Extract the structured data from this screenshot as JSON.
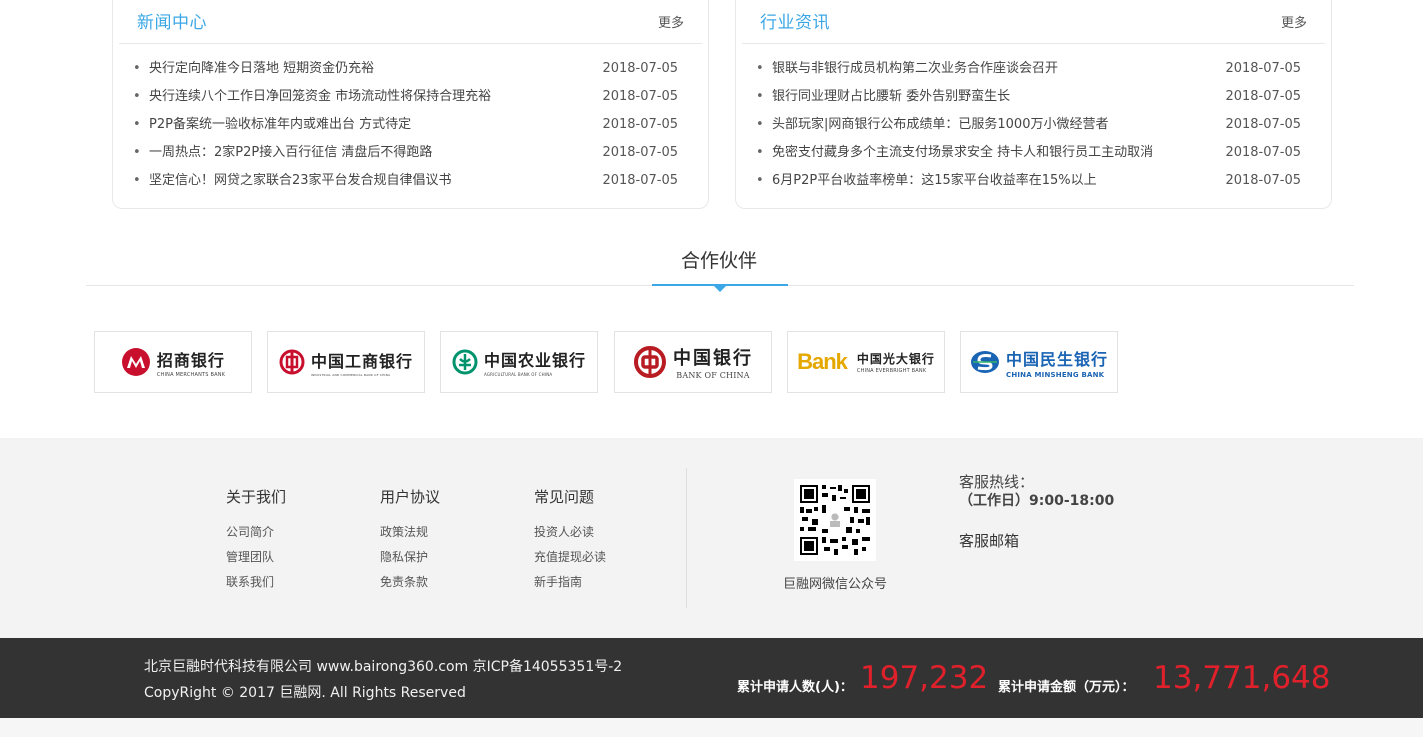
{
  "news": {
    "title": "新闻中心",
    "more": "更多",
    "items": [
      {
        "title": "央行定向降准今日落地 短期资金仍充裕",
        "date": "2018-07-05"
      },
      {
        "title": "央行连续八个工作日净回笼资金 市场流动性将保持合理充裕",
        "date": "2018-07-05"
      },
      {
        "title": "P2P备案统一验收标准年内或难出台 方式待定",
        "date": "2018-07-05"
      },
      {
        "title": "一周热点：2家P2P接入百行征信 清盘后不得跑路",
        "date": "2018-07-05"
      },
      {
        "title": "坚定信心！网贷之家联合23家平台发合规自律倡议书",
        "date": "2018-07-05"
      }
    ]
  },
  "industry": {
    "title": "行业资讯",
    "more": "更多",
    "items": [
      {
        "title": "银联与非银行成员机构第二次业务合作座谈会召开",
        "date": "2018-07-05"
      },
      {
        "title": "银行同业理财占比腰斩 委外告别野蛮生长",
        "date": "2018-07-05"
      },
      {
        "title": "头部玩家|网商银行公布成绩单：已服务1000万小微经营者",
        "date": "2018-07-05"
      },
      {
        "title": "免密支付藏身多个主流支付场景求安全 持卡人和银行员工主动取消",
        "date": "2018-07-05"
      },
      {
        "title": "6月P2P平台收益率榜单：这15家平台收益率在15%以上",
        "date": "2018-07-05"
      }
    ]
  },
  "partners": {
    "title": "合作伙伴",
    "logos": [
      {
        "cn": "招商银行",
        "en": "CHINA MERCHANTS BANK",
        "color": "#c8102e",
        "icon": "cmb-logo-icon"
      },
      {
        "cn": "中国工商银行",
        "en": "INDUSTRIAL AND COMMERCIAL BANK OF CHINA",
        "color": "#c8102e",
        "icon": "icbc-logo-icon"
      },
      {
        "cn": "中国农业银行",
        "en": "AGRICULTURAL BANK OF CHINA",
        "color": "#00936d",
        "icon": "abc-logo-icon"
      },
      {
        "cn": "中国银行",
        "en": "BANK OF CHINA",
        "color": "#b81c22",
        "icon": "boc-logo-icon"
      },
      {
        "cn": "中国光大银行",
        "en": "CHINA EVERBRIGHT BANK",
        "color": "#e5a800",
        "icon": "ceb-logo-icon",
        "mark": "Bank"
      },
      {
        "cn": "中国民生银行",
        "en": "CHINA MINSHENG BANK",
        "color": "#1a64b4",
        "icon": "cmbc-logo-icon"
      }
    ]
  },
  "footer": {
    "cols": [
      {
        "title": "关于我们",
        "links": [
          "公司简介",
          "管理团队",
          "联系我们"
        ]
      },
      {
        "title": "用户协议",
        "links": [
          "政策法规",
          "隐私保护",
          "免责条款"
        ]
      },
      {
        "title": "常见问题",
        "links": [
          "投资人必读",
          "充值提现必读",
          "新手指南"
        ]
      }
    ],
    "qr_caption": "巨融网微信公众号",
    "service_label": "客服热线：",
    "service_hours": "（工作日）9:00-18:00",
    "service_mail": "客服邮箱",
    "company": "北京巨融时代科技有限公司 www.bairong360.com 京ICP备14055351号-2",
    "copyright": "CopyRight © 2017 巨融网. All Rights Reserved",
    "stat1_label": "累计申请人数(人)：",
    "stat1_value": "197,232",
    "stat2_label": "累计申请金额（万元）：",
    "stat2_value": "13,771,648"
  }
}
